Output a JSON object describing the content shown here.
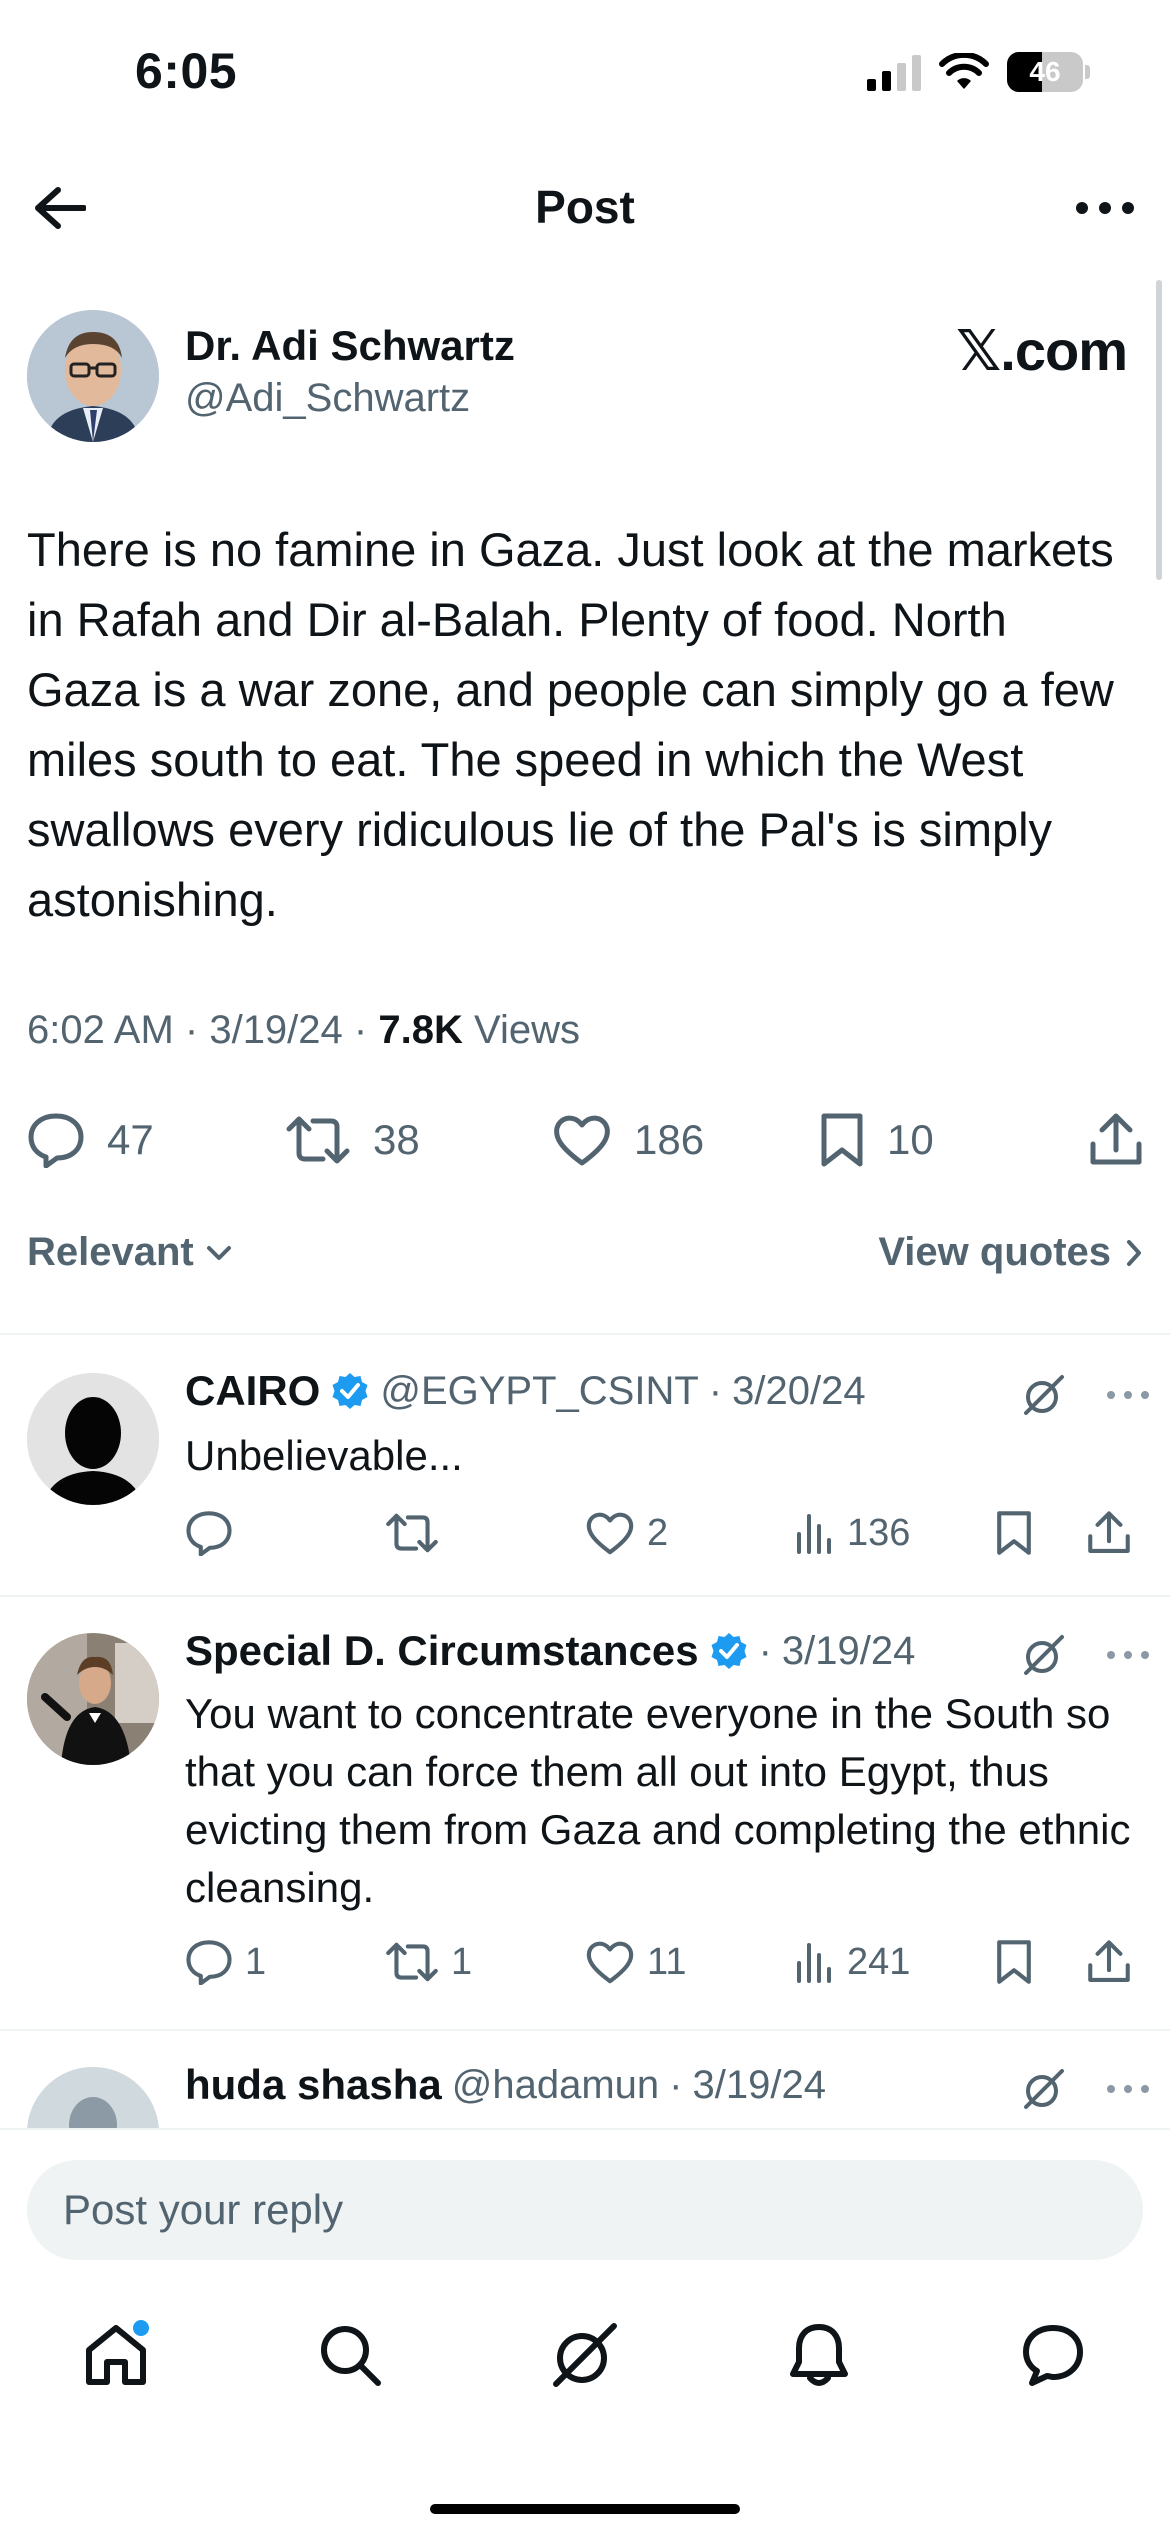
{
  "status_bar": {
    "time": "6:05",
    "battery": "46"
  },
  "header": {
    "title": "Post"
  },
  "post": {
    "author_name": "Dr. Adi Schwartz",
    "author_handle": "@Adi_Schwartz",
    "watermark": "𝕏.com",
    "text": "There is no famine in Gaza. Just look at the markets in Rafah and Dir al-Balah. Plenty of food. North Gaza is a war zone, and people can simply go a few miles south to eat. The speed in which the West swallows every ridiculous lie of the Pal's is simply astonishing.",
    "time": "6:02 AM",
    "date": "3/19/24",
    "views_count": "7.8K",
    "views_label": "Views",
    "replies": "47",
    "reposts": "38",
    "likes": "186",
    "bookmarks": "10"
  },
  "sort": {
    "relevant_label": "Relevant",
    "view_quotes_label": "View quotes"
  },
  "replies": [
    {
      "name": "CAIRO",
      "verified": true,
      "handle": "@EGYPT_CSINT",
      "date": "3/20/24",
      "text": "Unbelievable...",
      "replies": "",
      "reposts": "",
      "likes": "2",
      "views": "136"
    },
    {
      "name": "Special D. Circumstances",
      "verified": true,
      "handle": "",
      "date": "3/19/24",
      "text": "You want to concentrate everyone in the South so that you can force them all out into Egypt, thus evicting them from Gaza and completing the ethnic cleansing.",
      "replies": "1",
      "reposts": "1",
      "likes": "11",
      "views": "241"
    },
    {
      "name": "huda shasha",
      "verified": false,
      "handle": "@hadamun",
      "date": "3/19/24"
    }
  ],
  "composer": {
    "placeholder": "Post your reply"
  },
  "colors": {
    "accent": "#1d9bf0",
    "text": "#0f1419",
    "muted": "#536471",
    "divider": "#eff3f4"
  }
}
